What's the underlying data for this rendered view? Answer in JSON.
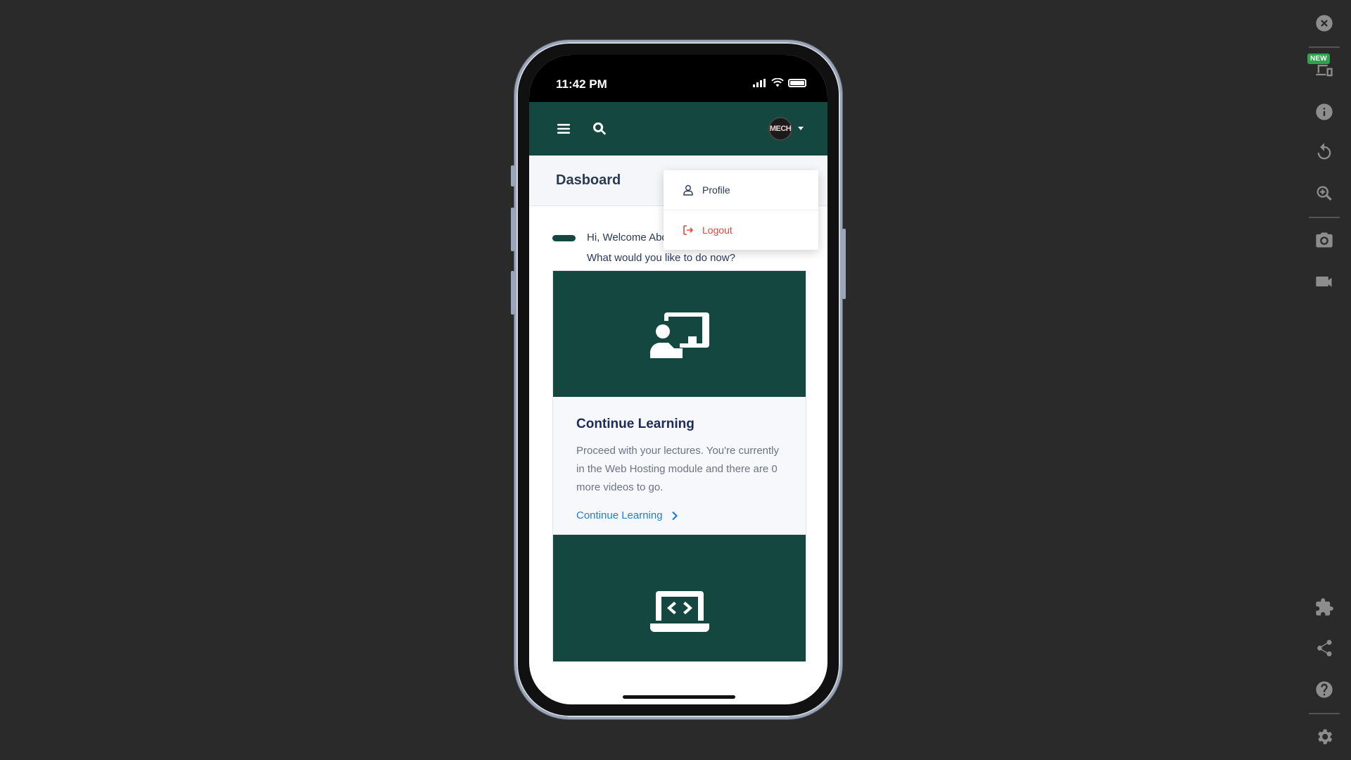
{
  "status_bar": {
    "time": "11:42 PM"
  },
  "header": {
    "avatar_text": "MECH"
  },
  "dropdown": {
    "items": [
      {
        "label": "Profile",
        "color": "#2a3a52",
        "icon": "user-icon"
      },
      {
        "label": "Logout",
        "color": "#e0463f",
        "icon": "logout-icon"
      }
    ]
  },
  "page": {
    "title": "Dasboard"
  },
  "welcome": {
    "line1": "Hi, Welcome Abdulqoyum!",
    "line2": "What would you like to do now?"
  },
  "cards": [
    {
      "icon": "presentation-icon",
      "title": "Continue Learning",
      "text": "Proceed with your lectures. You're currently in the Web Hosting module and there are 0 more videos to go.",
      "link": "Continue Learning"
    },
    {
      "icon": "laptop-code-icon"
    }
  ],
  "toolbar": {
    "badge": "NEW",
    "icons": [
      "close-icon",
      "devices-icon",
      "info-icon",
      "rotate-icon",
      "zoom-in-icon",
      "camera-icon",
      "video-icon",
      "puzzle-icon",
      "share-icon",
      "help-icon",
      "gear-icon"
    ]
  },
  "colors": {
    "brand": "#13473f",
    "link": "#1d7fd6",
    "logout": "#e0463f",
    "background": "#2a2a2a"
  }
}
